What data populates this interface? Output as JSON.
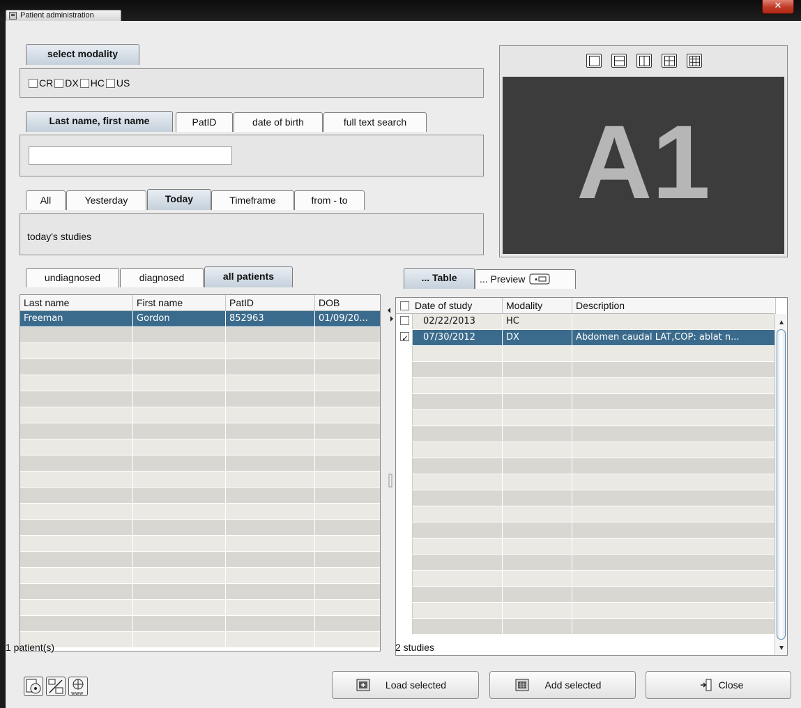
{
  "window": {
    "title": "Patient administration",
    "close_glyph": "✕"
  },
  "modality": {
    "tab_label": "select modality",
    "options": [
      {
        "label": "CR",
        "checked": false
      },
      {
        "label": "DX",
        "checked": false
      },
      {
        "label": "HC",
        "checked": false
      },
      {
        "label": "US",
        "checked": false
      }
    ]
  },
  "search": {
    "tabs": [
      "Last name, first name",
      "PatID",
      "date of birth",
      "full text search"
    ],
    "active_tab": 0,
    "value": ""
  },
  "date_filter": {
    "tabs": [
      "All",
      "Yesterday",
      "Today",
      "Timeframe",
      "from - to"
    ],
    "active_tab": 2,
    "description": "today's studies"
  },
  "preview": {
    "label": "A1",
    "layouts": [
      "layout-1x1-icon",
      "layout-2-rows-icon",
      "layout-2-cols-icon",
      "layout-2x2-icon",
      "layout-3x3-icon"
    ]
  },
  "patients": {
    "tabs": [
      "undiagnosed",
      "diagnosed",
      "all patients"
    ],
    "active_tab": 2,
    "columns": [
      "Last name",
      "First name",
      "PatID",
      "DOB"
    ],
    "rows": [
      {
        "last": "Freeman",
        "first": "Gordon",
        "patid": "852963",
        "dob": "01/09/20...",
        "selected": true
      }
    ],
    "status": "1 patient(s)"
  },
  "studies": {
    "tabs": [
      "... Table",
      "... Preview"
    ],
    "active_tab": 0,
    "columns": [
      "Date of study",
      "Modality",
      "Description"
    ],
    "rows": [
      {
        "date": "02/22/2013",
        "modality": "HC",
        "description": "",
        "checked": false,
        "selected": false
      },
      {
        "date": "07/30/2012",
        "modality": "DX",
        "description": "Abdomen caudal LAT,COP: ablat n...",
        "checked": true,
        "selected": true
      }
    ],
    "status": "2 studies"
  },
  "footer": {
    "load_label": "Load selected",
    "add_label": "Add selected",
    "close_label": "Close"
  },
  "colors": {
    "selection": "#3b6b8c",
    "row_alt": "#d9d7d1",
    "row_base": "#ebe9e3",
    "preview_bg": "#3c3c3c"
  }
}
